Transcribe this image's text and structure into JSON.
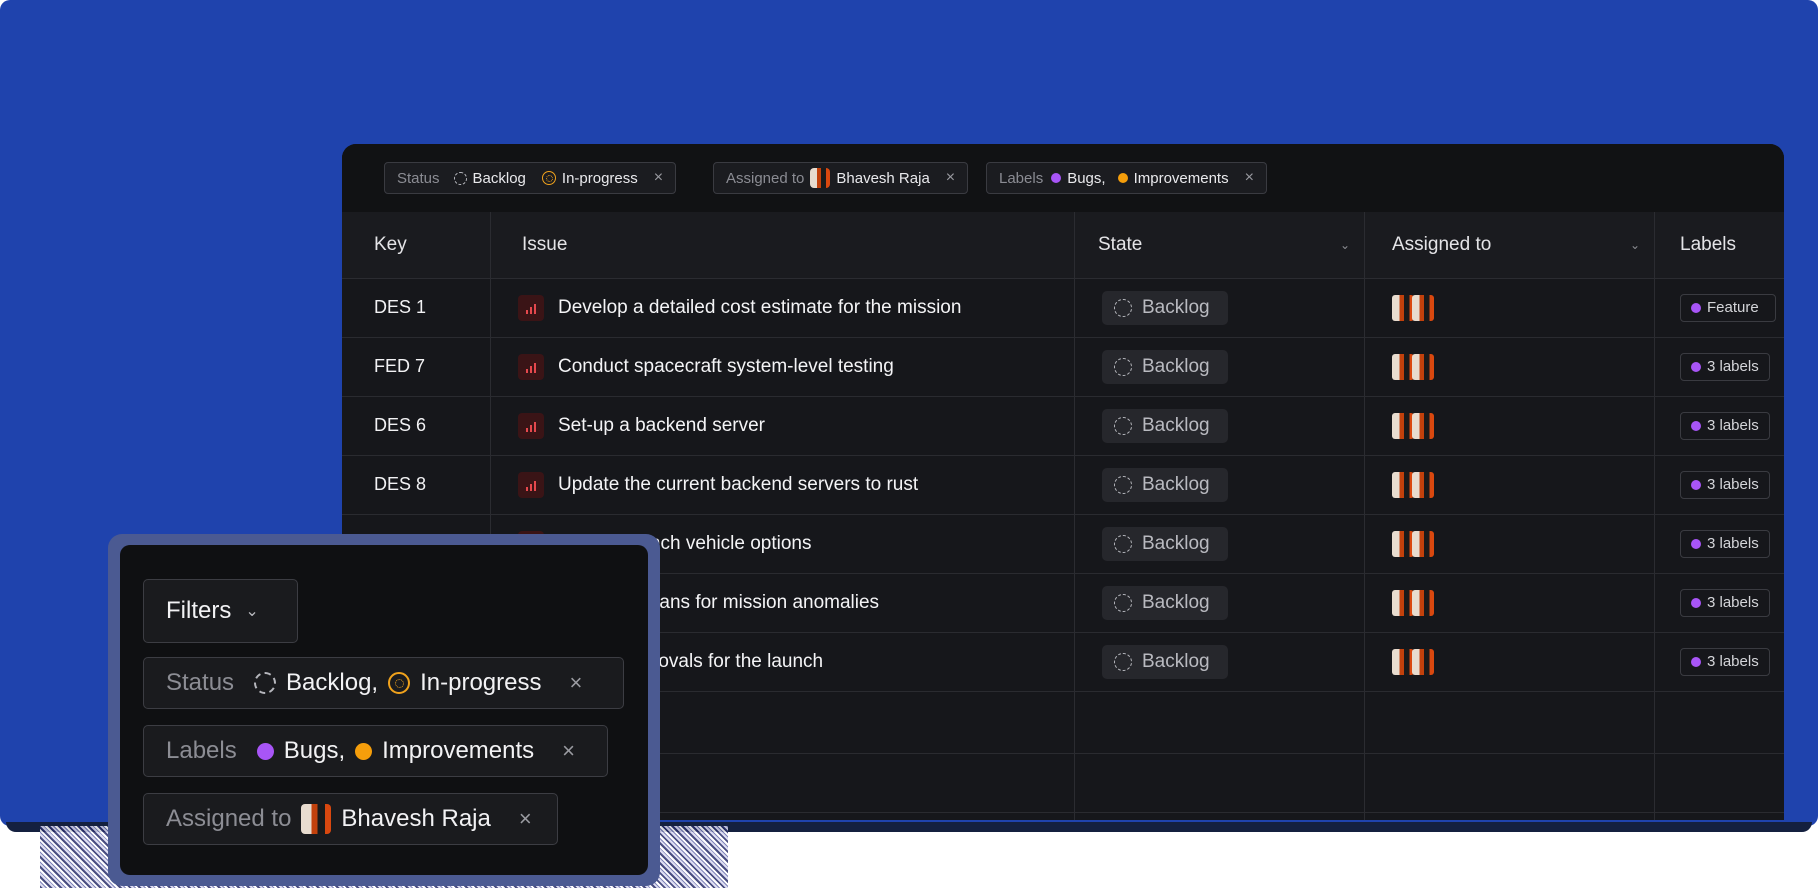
{
  "filter_bar": {
    "status": {
      "label": "Status",
      "values": [
        "Backlog",
        "In-progress"
      ]
    },
    "assigned": {
      "label": "Assigned to",
      "value": "Bhavesh Raja"
    },
    "labels": {
      "label": "Labels",
      "values": [
        "Bugs,",
        "Improvements"
      ]
    },
    "remove_icon": "×"
  },
  "table": {
    "columns": [
      "Key",
      "Issue",
      "State",
      "Assigned to",
      "Labels"
    ],
    "rows": [
      {
        "key": "DES 1",
        "issue": "Develop a detailed cost estimate for the mission",
        "state": "Backlog",
        "labels": "Feature"
      },
      {
        "key": "FED 7",
        "issue": "Conduct spacecraft system-level testing",
        "state": "Backlog",
        "labels": "3 labels"
      },
      {
        "key": "DES 6",
        "issue": "Set-up a backend server",
        "state": "Backlog",
        "labels": "3 labels"
      },
      {
        "key": "DES 8",
        "issue": "Update the current backend servers to rust",
        "state": "Backlog",
        "labels": "3 labels"
      },
      {
        "key": "",
        "issue": "otential launch vehicle options",
        "state": "Backlog",
        "labels": "3 labels"
      },
      {
        "key": "",
        "issue": "ntingency plans for mission anomalies",
        "state": "Backlog",
        "labels": "3 labels"
      },
      {
        "key": "",
        "issue": "ulatory approvals for the launch",
        "state": "Backlog",
        "labels": "3 labels"
      }
    ]
  },
  "panel": {
    "filters_button": "Filters",
    "status": {
      "label": "Status",
      "values": [
        "Backlog,",
        "In-progress"
      ]
    },
    "labels": {
      "label": "Labels",
      "values": [
        "Bugs,",
        "Improvements"
      ]
    },
    "assigned": {
      "label": "Assigned to",
      "value": "Bhavesh Raja"
    }
  },
  "colors": {
    "background": "#1f43ad",
    "bugs": "#a855f7",
    "improvements": "#f59e0b",
    "priority": "#e5484d",
    "label_dot": "#a855f7"
  }
}
